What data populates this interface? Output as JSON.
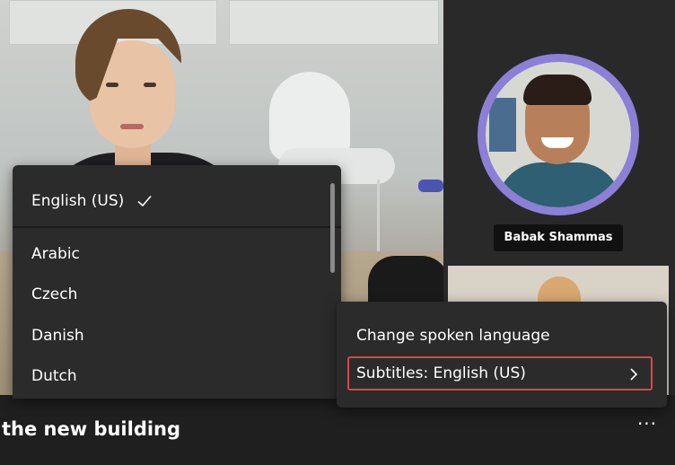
{
  "participants": {
    "remote_name": "Babak Shammas"
  },
  "language_menu": {
    "selected": "English (US)",
    "items": [
      "Arabic",
      "Czech",
      "Danish",
      "Dutch"
    ]
  },
  "context_menu": {
    "change_language_label": "Change spoken language",
    "subtitles_label": "Subtitles: English (US)"
  },
  "caption": {
    "text": "the new building"
  },
  "more_label": "...",
  "colors": {
    "menu_bg": "#2b2b2b",
    "highlight_border": "#d54a45",
    "avatar_ring": "#8b7fd6"
  },
  "icons": {
    "check": "check-icon",
    "chevron": "chevron-right-icon"
  }
}
